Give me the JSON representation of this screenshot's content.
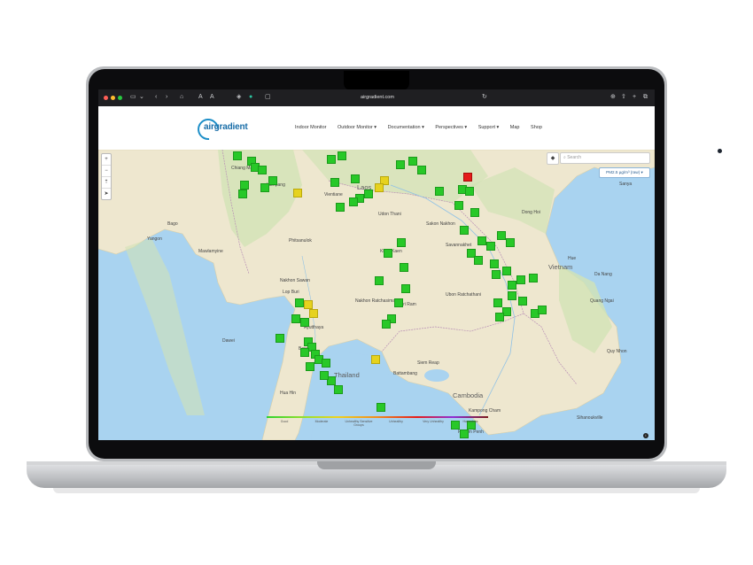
{
  "browser": {
    "url": "airgradient.com"
  },
  "site": {
    "logo_text": "airgradient",
    "nav": [
      {
        "label": "Indoor Monitor"
      },
      {
        "label": "Outdoor Monitor ▾"
      },
      {
        "label": "Documentation ▾"
      },
      {
        "label": "Perspectives ▾"
      },
      {
        "label": "Support ▾"
      },
      {
        "label": "Map"
      },
      {
        "label": "Shop"
      }
    ]
  },
  "map": {
    "search_placeholder": "Search",
    "pollutant_select": "PM2.5 µg/m³ (raw) ▾",
    "zoom_in": "+",
    "zoom_out": "−",
    "countries": [
      "Laos",
      "Thailand",
      "Cambodia",
      "Vietnam"
    ],
    "places": [
      "Yangon",
      "Bago",
      "Mawlamyine",
      "Dawei",
      "Phitsanulok",
      "Nakhon Sawan",
      "Lop Buri",
      "Ayutthaya",
      "Bangkok",
      "Khon Kaen",
      "Udon Thani",
      "Sakon Nakhon",
      "Savannakhet",
      "Ubon Ratchathani",
      "Nakhon Ratchasima",
      "Buri Ram",
      "Siem Reap",
      "Battambang",
      "Kampong Cham",
      "Phnom Penh",
      "Da Nang",
      "Quang Ngai",
      "Quy Nhon",
      "Dong Hoi",
      "Hue",
      "Hua Hin",
      "Lampang",
      "Chiang Mai",
      "Vientiane",
      "Sihanoukville",
      "Sanya"
    ],
    "markers_count_label": "",
    "legend": [
      "Good",
      "Moderate",
      "Unhealthy Sensitive Groups",
      "Unhealthy",
      "Very Unhealthy",
      "Hazardous"
    ],
    "colors": {
      "good": "#28c828",
      "moderate": "#e6d21e",
      "unhealthy": "#e51b1b",
      "water": "#a9d3f0",
      "land": "#eee7cf"
    }
  }
}
